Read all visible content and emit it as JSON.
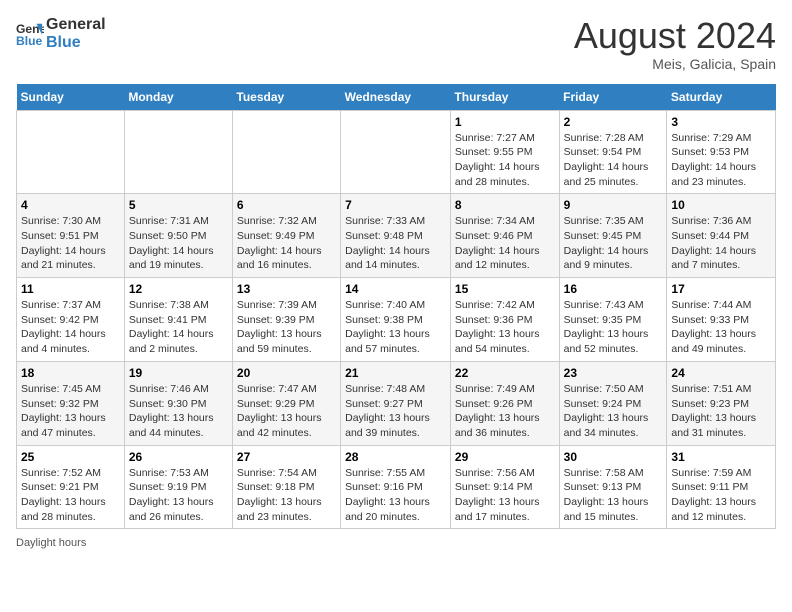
{
  "header": {
    "logo_line1": "General",
    "logo_line2": "Blue",
    "month_year": "August 2024",
    "location": "Meis, Galicia, Spain"
  },
  "days_of_week": [
    "Sunday",
    "Monday",
    "Tuesday",
    "Wednesday",
    "Thursday",
    "Friday",
    "Saturday"
  ],
  "weeks": [
    [
      {
        "day": "",
        "info": ""
      },
      {
        "day": "",
        "info": ""
      },
      {
        "day": "",
        "info": ""
      },
      {
        "day": "",
        "info": ""
      },
      {
        "day": "1",
        "info": "Sunrise: 7:27 AM\nSunset: 9:55 PM\nDaylight: 14 hours and 28 minutes."
      },
      {
        "day": "2",
        "info": "Sunrise: 7:28 AM\nSunset: 9:54 PM\nDaylight: 14 hours and 25 minutes."
      },
      {
        "day": "3",
        "info": "Sunrise: 7:29 AM\nSunset: 9:53 PM\nDaylight: 14 hours and 23 minutes."
      }
    ],
    [
      {
        "day": "4",
        "info": "Sunrise: 7:30 AM\nSunset: 9:51 PM\nDaylight: 14 hours and 21 minutes."
      },
      {
        "day": "5",
        "info": "Sunrise: 7:31 AM\nSunset: 9:50 PM\nDaylight: 14 hours and 19 minutes."
      },
      {
        "day": "6",
        "info": "Sunrise: 7:32 AM\nSunset: 9:49 PM\nDaylight: 14 hours and 16 minutes."
      },
      {
        "day": "7",
        "info": "Sunrise: 7:33 AM\nSunset: 9:48 PM\nDaylight: 14 hours and 14 minutes."
      },
      {
        "day": "8",
        "info": "Sunrise: 7:34 AM\nSunset: 9:46 PM\nDaylight: 14 hours and 12 minutes."
      },
      {
        "day": "9",
        "info": "Sunrise: 7:35 AM\nSunset: 9:45 PM\nDaylight: 14 hours and 9 minutes."
      },
      {
        "day": "10",
        "info": "Sunrise: 7:36 AM\nSunset: 9:44 PM\nDaylight: 14 hours and 7 minutes."
      }
    ],
    [
      {
        "day": "11",
        "info": "Sunrise: 7:37 AM\nSunset: 9:42 PM\nDaylight: 14 hours and 4 minutes."
      },
      {
        "day": "12",
        "info": "Sunrise: 7:38 AM\nSunset: 9:41 PM\nDaylight: 14 hours and 2 minutes."
      },
      {
        "day": "13",
        "info": "Sunrise: 7:39 AM\nSunset: 9:39 PM\nDaylight: 13 hours and 59 minutes."
      },
      {
        "day": "14",
        "info": "Sunrise: 7:40 AM\nSunset: 9:38 PM\nDaylight: 13 hours and 57 minutes."
      },
      {
        "day": "15",
        "info": "Sunrise: 7:42 AM\nSunset: 9:36 PM\nDaylight: 13 hours and 54 minutes."
      },
      {
        "day": "16",
        "info": "Sunrise: 7:43 AM\nSunset: 9:35 PM\nDaylight: 13 hours and 52 minutes."
      },
      {
        "day": "17",
        "info": "Sunrise: 7:44 AM\nSunset: 9:33 PM\nDaylight: 13 hours and 49 minutes."
      }
    ],
    [
      {
        "day": "18",
        "info": "Sunrise: 7:45 AM\nSunset: 9:32 PM\nDaylight: 13 hours and 47 minutes."
      },
      {
        "day": "19",
        "info": "Sunrise: 7:46 AM\nSunset: 9:30 PM\nDaylight: 13 hours and 44 minutes."
      },
      {
        "day": "20",
        "info": "Sunrise: 7:47 AM\nSunset: 9:29 PM\nDaylight: 13 hours and 42 minutes."
      },
      {
        "day": "21",
        "info": "Sunrise: 7:48 AM\nSunset: 9:27 PM\nDaylight: 13 hours and 39 minutes."
      },
      {
        "day": "22",
        "info": "Sunrise: 7:49 AM\nSunset: 9:26 PM\nDaylight: 13 hours and 36 minutes."
      },
      {
        "day": "23",
        "info": "Sunrise: 7:50 AM\nSunset: 9:24 PM\nDaylight: 13 hours and 34 minutes."
      },
      {
        "day": "24",
        "info": "Sunrise: 7:51 AM\nSunset: 9:23 PM\nDaylight: 13 hours and 31 minutes."
      }
    ],
    [
      {
        "day": "25",
        "info": "Sunrise: 7:52 AM\nSunset: 9:21 PM\nDaylight: 13 hours and 28 minutes."
      },
      {
        "day": "26",
        "info": "Sunrise: 7:53 AM\nSunset: 9:19 PM\nDaylight: 13 hours and 26 minutes."
      },
      {
        "day": "27",
        "info": "Sunrise: 7:54 AM\nSunset: 9:18 PM\nDaylight: 13 hours and 23 minutes."
      },
      {
        "day": "28",
        "info": "Sunrise: 7:55 AM\nSunset: 9:16 PM\nDaylight: 13 hours and 20 minutes."
      },
      {
        "day": "29",
        "info": "Sunrise: 7:56 AM\nSunset: 9:14 PM\nDaylight: 13 hours and 17 minutes."
      },
      {
        "day": "30",
        "info": "Sunrise: 7:58 AM\nSunset: 9:13 PM\nDaylight: 13 hours and 15 minutes."
      },
      {
        "day": "31",
        "info": "Sunrise: 7:59 AM\nSunset: 9:11 PM\nDaylight: 13 hours and 12 minutes."
      }
    ]
  ],
  "footer": {
    "daylight_label": "Daylight hours"
  }
}
